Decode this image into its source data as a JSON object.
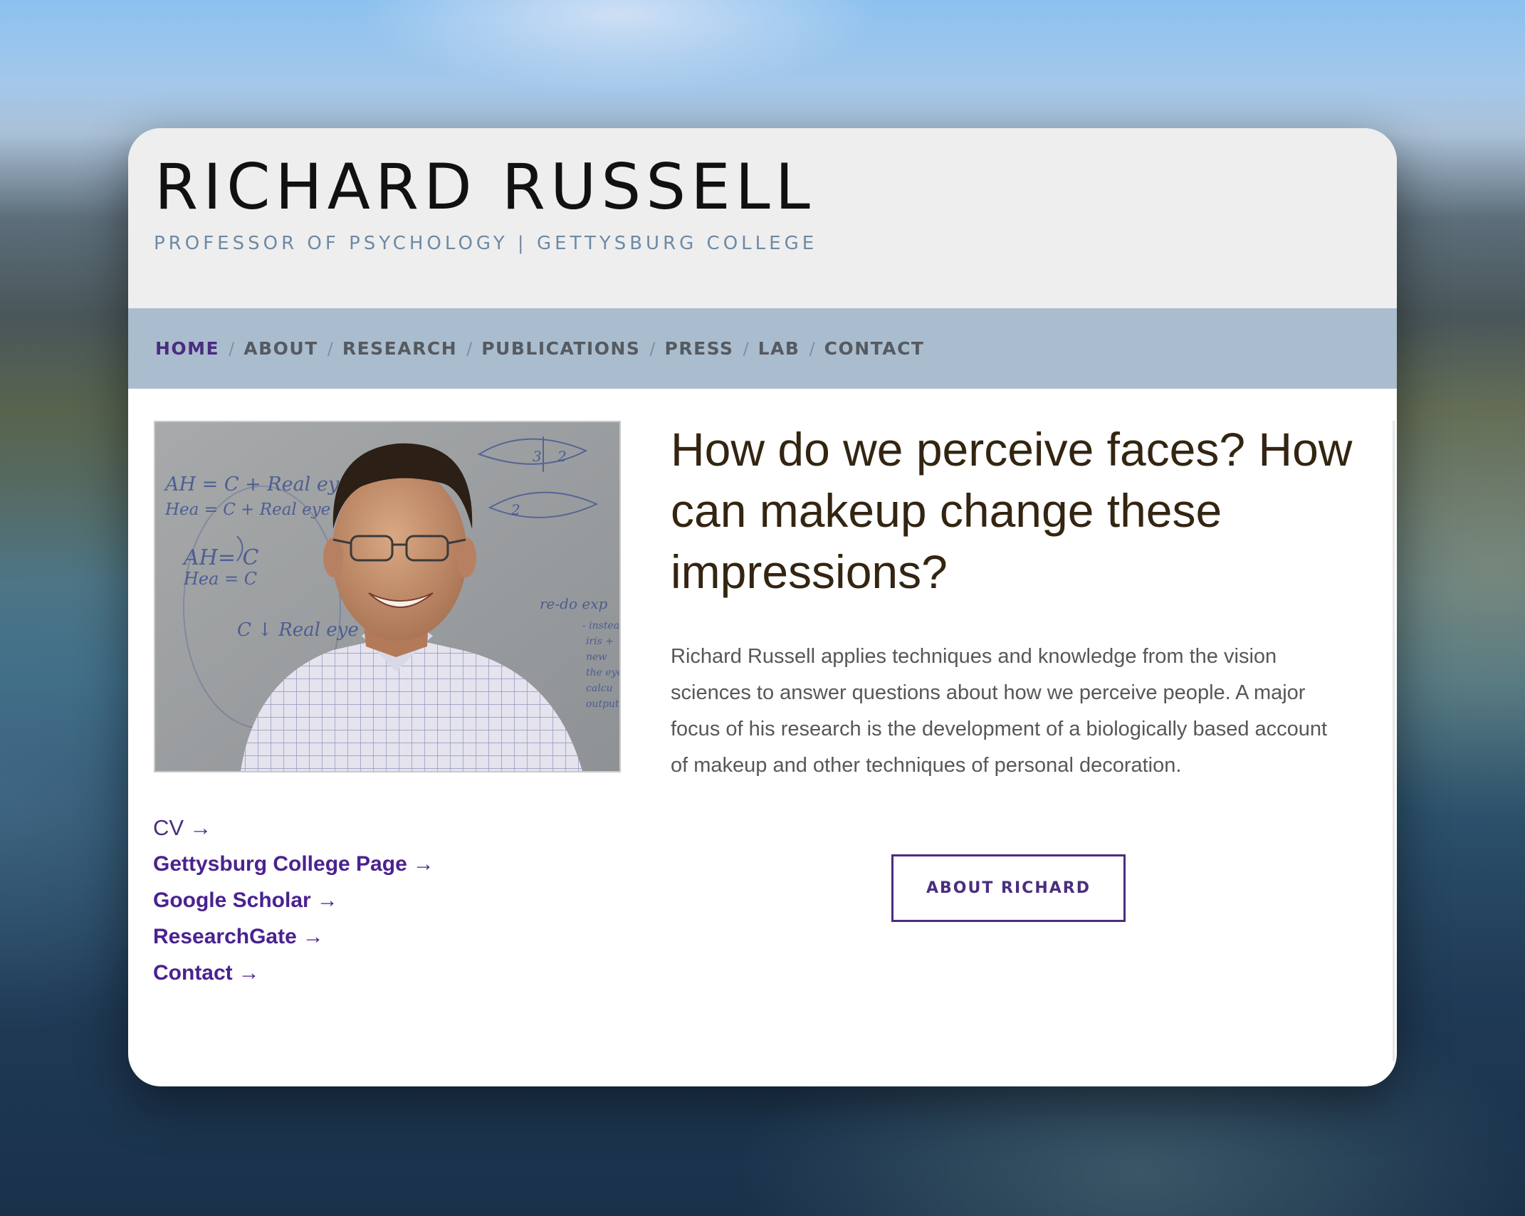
{
  "site": {
    "title": "RICHARD RUSSELL",
    "subtitle": "PROFESSOR OF PSYCHOLOGY | GETTYSBURG COLLEGE"
  },
  "nav": {
    "separator": "/",
    "items": [
      {
        "label": "HOME",
        "active": true
      },
      {
        "label": "ABOUT",
        "active": false
      },
      {
        "label": "RESEARCH",
        "active": false
      },
      {
        "label": "PUBLICATIONS",
        "active": false
      },
      {
        "label": "PRESS",
        "active": false
      },
      {
        "label": "LAB",
        "active": false
      },
      {
        "label": "CONTACT",
        "active": false
      }
    ]
  },
  "photo": {
    "whiteboard_lines": [
      "AH = C + Real eye",
      "Hea = C + Real eye",
      "AH= C",
      "Hea = C",
      "C ↓ Real eye",
      "re-do exp",
      "- instead",
      "iris +",
      "new",
      "the eye",
      "calcu",
      "output"
    ],
    "diagram_labels": [
      "3",
      "2",
      "2"
    ]
  },
  "links": [
    {
      "label": "CV",
      "arrow": "→",
      "style": "plain"
    },
    {
      "label": "Gettysburg College Page",
      "arrow": "→",
      "style": "bold"
    },
    {
      "label": "Google Scholar",
      "arrow": "→",
      "style": "bold"
    },
    {
      "label": "ResearchGate",
      "arrow": "→",
      "style": "bold"
    },
    {
      "label": "Contact",
      "arrow": "→",
      "style": "bold"
    }
  ],
  "main": {
    "headline": "How do we perceive faces? How can makeup change these impressions?",
    "intro": "Richard Russell applies techniques and knowledge from the vision sciences to answer questions about how we perceive people. A major focus of his research is the development of a biologically based account of makeup and other techniques of personal decoration.",
    "button_label": "ABOUT RICHARD"
  },
  "colors": {
    "accent": "#4a2d7f",
    "nav_bg": "#aabdce",
    "header_bg": "#eeeeee",
    "subtitle": "#6d8aa6",
    "headline": "#332511"
  }
}
